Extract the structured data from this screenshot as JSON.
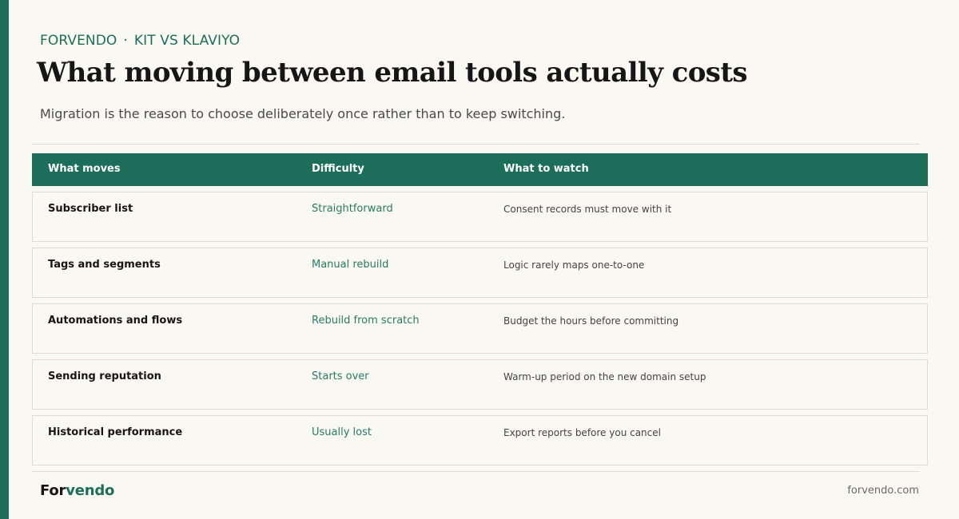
{
  "eyebrow": {
    "brand": "FORVENDO",
    "separator": "·",
    "topic": "KIT VS KLAVIYO"
  },
  "title": "What moving between email tools actually costs",
  "subtitle": "Migration is the reason to choose deliberately once rather than to keep switching.",
  "table": {
    "headers": [
      "What moves",
      "Difficulty",
      "What to watch"
    ],
    "rows": [
      [
        "Subscriber list",
        "Straightforward",
        "Consent records must move with it"
      ],
      [
        "Tags and segments",
        "Manual rebuild",
        "Logic rarely maps one-to-one"
      ],
      [
        "Automations and flows",
        "Rebuild from scratch",
        "Budget the hours before committing"
      ],
      [
        "Sending reputation",
        "Starts over",
        "Warm-up period on the new domain setup"
      ],
      [
        "Historical performance",
        "Usually lost",
        "Export reports before you cancel"
      ]
    ]
  },
  "footer": {
    "brand_part1": "For",
    "brand_part2": "vendo",
    "domain": "forvendo.com"
  },
  "colors": {
    "accent": "#1d6e59",
    "background": "#f9f8f3",
    "text": "#161616"
  }
}
